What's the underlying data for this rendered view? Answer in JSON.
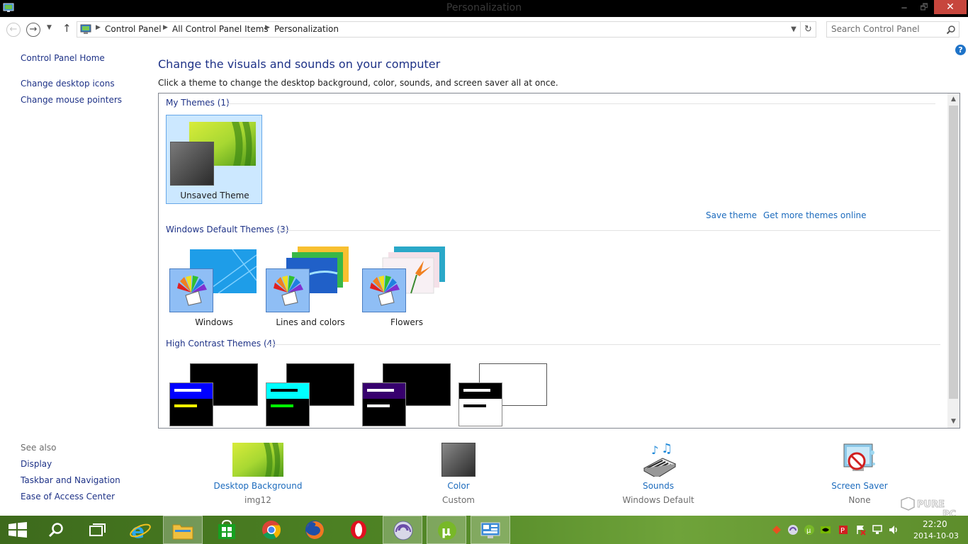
{
  "window": {
    "title": "Personalization",
    "minimize_glyph": "🗕",
    "maximize_glyph": "🗗",
    "close_glyph": "✕"
  },
  "nav": {
    "back_glyph": "←",
    "forward_glyph": "→",
    "recent_glyph": "▼",
    "up_glyph": "↑",
    "breadcrumbs": [
      "Control Panel",
      "All Control Panel Items",
      "Personalization"
    ],
    "separator_glyph": "▶",
    "dropdown_glyph": "▼",
    "refresh_glyph": "↻"
  },
  "search": {
    "placeholder": "Search Control Panel"
  },
  "help_glyph": "?",
  "sidebar": {
    "home": "Control Panel Home",
    "links": [
      "Change desktop icons",
      "Change mouse pointers"
    ],
    "see_also_title": "See also",
    "see_also": [
      "Display",
      "Taskbar and Navigation",
      "Ease of Access Center"
    ]
  },
  "main": {
    "heading": "Change the visuals and sounds on your computer",
    "subheading": "Click a theme to change the desktop background, color, sounds, and screen saver all at once."
  },
  "themes": {
    "my_themes": {
      "title": "My Themes (1)",
      "items": [
        {
          "label": "Unsaved Theme",
          "selected": true
        }
      ],
      "save_link": "Save theme",
      "more_link": "Get more themes online"
    },
    "default_themes": {
      "title": "Windows Default Themes (3)",
      "items": [
        {
          "label": "Windows"
        },
        {
          "label": "Lines and colors"
        },
        {
          "label": "Flowers"
        }
      ]
    },
    "high_contrast": {
      "title": "High Contrast Themes (4)",
      "items": [
        {
          "bar1": "#0000ff",
          "bar2": "#ffff00",
          "bg": "#000000"
        },
        {
          "bar1": "#00ffff",
          "bar2": "#00ff00",
          "bg": "#000000"
        },
        {
          "bar1": "#37006e",
          "bar2": "#ffffff",
          "bg": "#000000"
        },
        {
          "bar1": "#000000",
          "bar2": "#000000",
          "bg": "#ffffff"
        }
      ]
    },
    "scroll_up_glyph": "▲",
    "scroll_down_glyph": "▼"
  },
  "bottom": [
    {
      "label": "Desktop Background",
      "value": "img12",
      "icon": "desktop-background-icon"
    },
    {
      "label": "Color",
      "value": "Custom",
      "icon": "color-swatch-icon"
    },
    {
      "label": "Sounds",
      "value": "Windows Default",
      "icon": "sounds-icon"
    },
    {
      "label": "Screen Saver",
      "value": "None",
      "icon": "screen-saver-icon"
    }
  ],
  "taskbar": {
    "apps": [
      "start-icon",
      "search-icon",
      "task-view-icon",
      "internet-explorer-icon",
      "file-explorer-icon",
      "store-icon",
      "chrome-icon",
      "firefox-icon",
      "opera-icon",
      "bittorrent-icon",
      "utorrent-icon",
      "control-panel-icon"
    ],
    "clock_time": "22:20",
    "clock_date": "2014-10-03",
    "watermark": "PURE PC"
  },
  "colors": {
    "link": "#1c6bbd",
    "heading": "#1e3287",
    "selection": "#cce8ff",
    "close_button": "#c7463d",
    "taskbar": "#4e8324"
  }
}
